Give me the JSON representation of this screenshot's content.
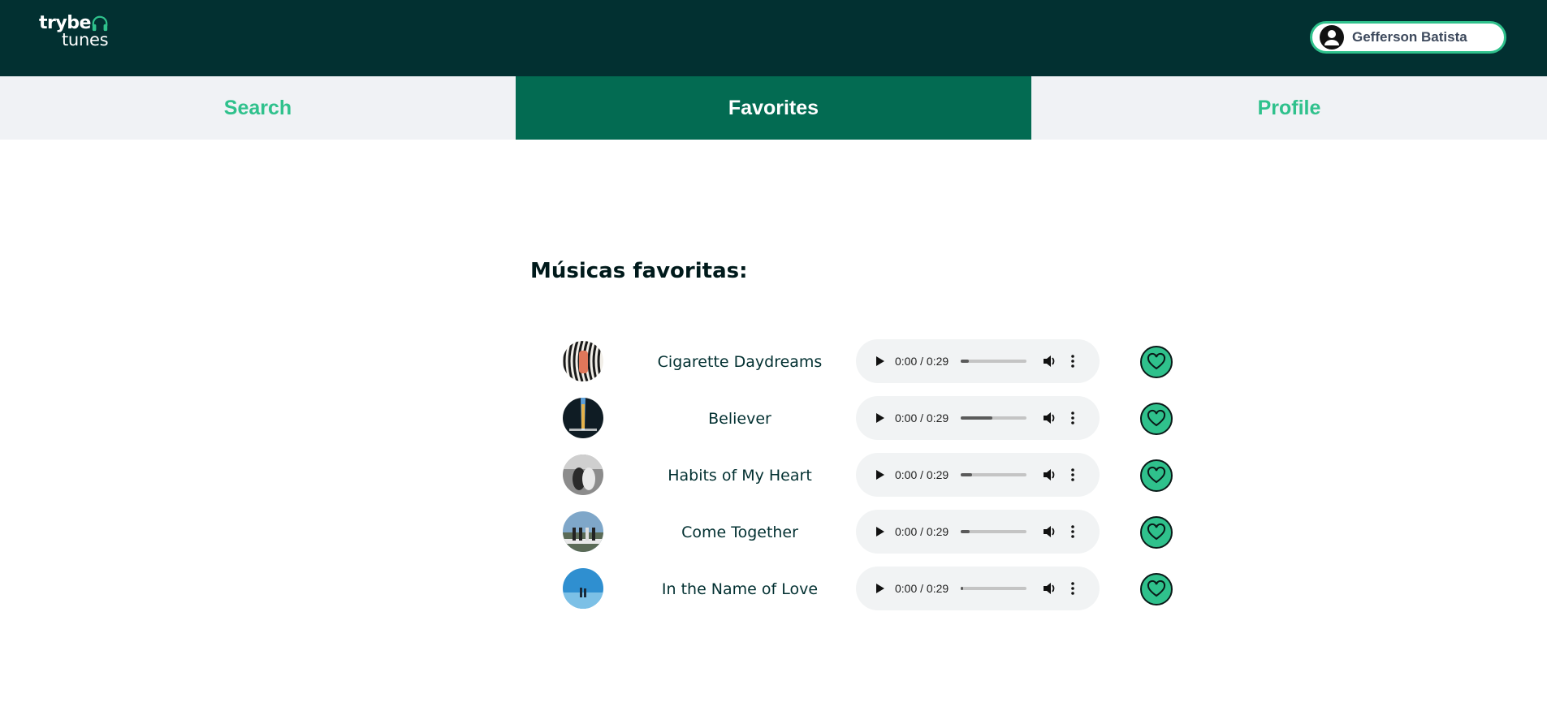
{
  "header": {
    "logo": {
      "line1": "trybe",
      "line2": "tunes",
      "icon": "headphones-icon",
      "accent": "#2fc18c"
    },
    "user": {
      "name": "Gefferson Batista",
      "icon": "user-avatar-icon"
    }
  },
  "nav": {
    "tabs": [
      {
        "label": "Search",
        "active": false
      },
      {
        "label": "Favorites",
        "active": true
      },
      {
        "label": "Profile",
        "active": false
      }
    ]
  },
  "main": {
    "heading": "Músicas favoritas:",
    "tracks": [
      {
        "title": "Cigarette Daydreams",
        "time": "0:00 / 0:29",
        "progress": 0.12,
        "favorite": true
      },
      {
        "title": "Believer",
        "time": "0:00 / 0:29",
        "progress": 0.48,
        "favorite": true
      },
      {
        "title": "Habits of My Heart",
        "time": "0:00 / 0:29",
        "progress": 0.17,
        "favorite": true
      },
      {
        "title": "Come Together",
        "time": "0:00 / 0:29",
        "progress": 0.14,
        "favorite": true
      },
      {
        "title": "In the Name of Love",
        "time": "0:00 / 0:29",
        "progress": 0.04,
        "favorite": true
      }
    ]
  },
  "colors": {
    "header_bg": "#023031",
    "active_tab_bg": "#036b52",
    "tab_bg": "#f0f2f5",
    "accent": "#2fc18c"
  }
}
